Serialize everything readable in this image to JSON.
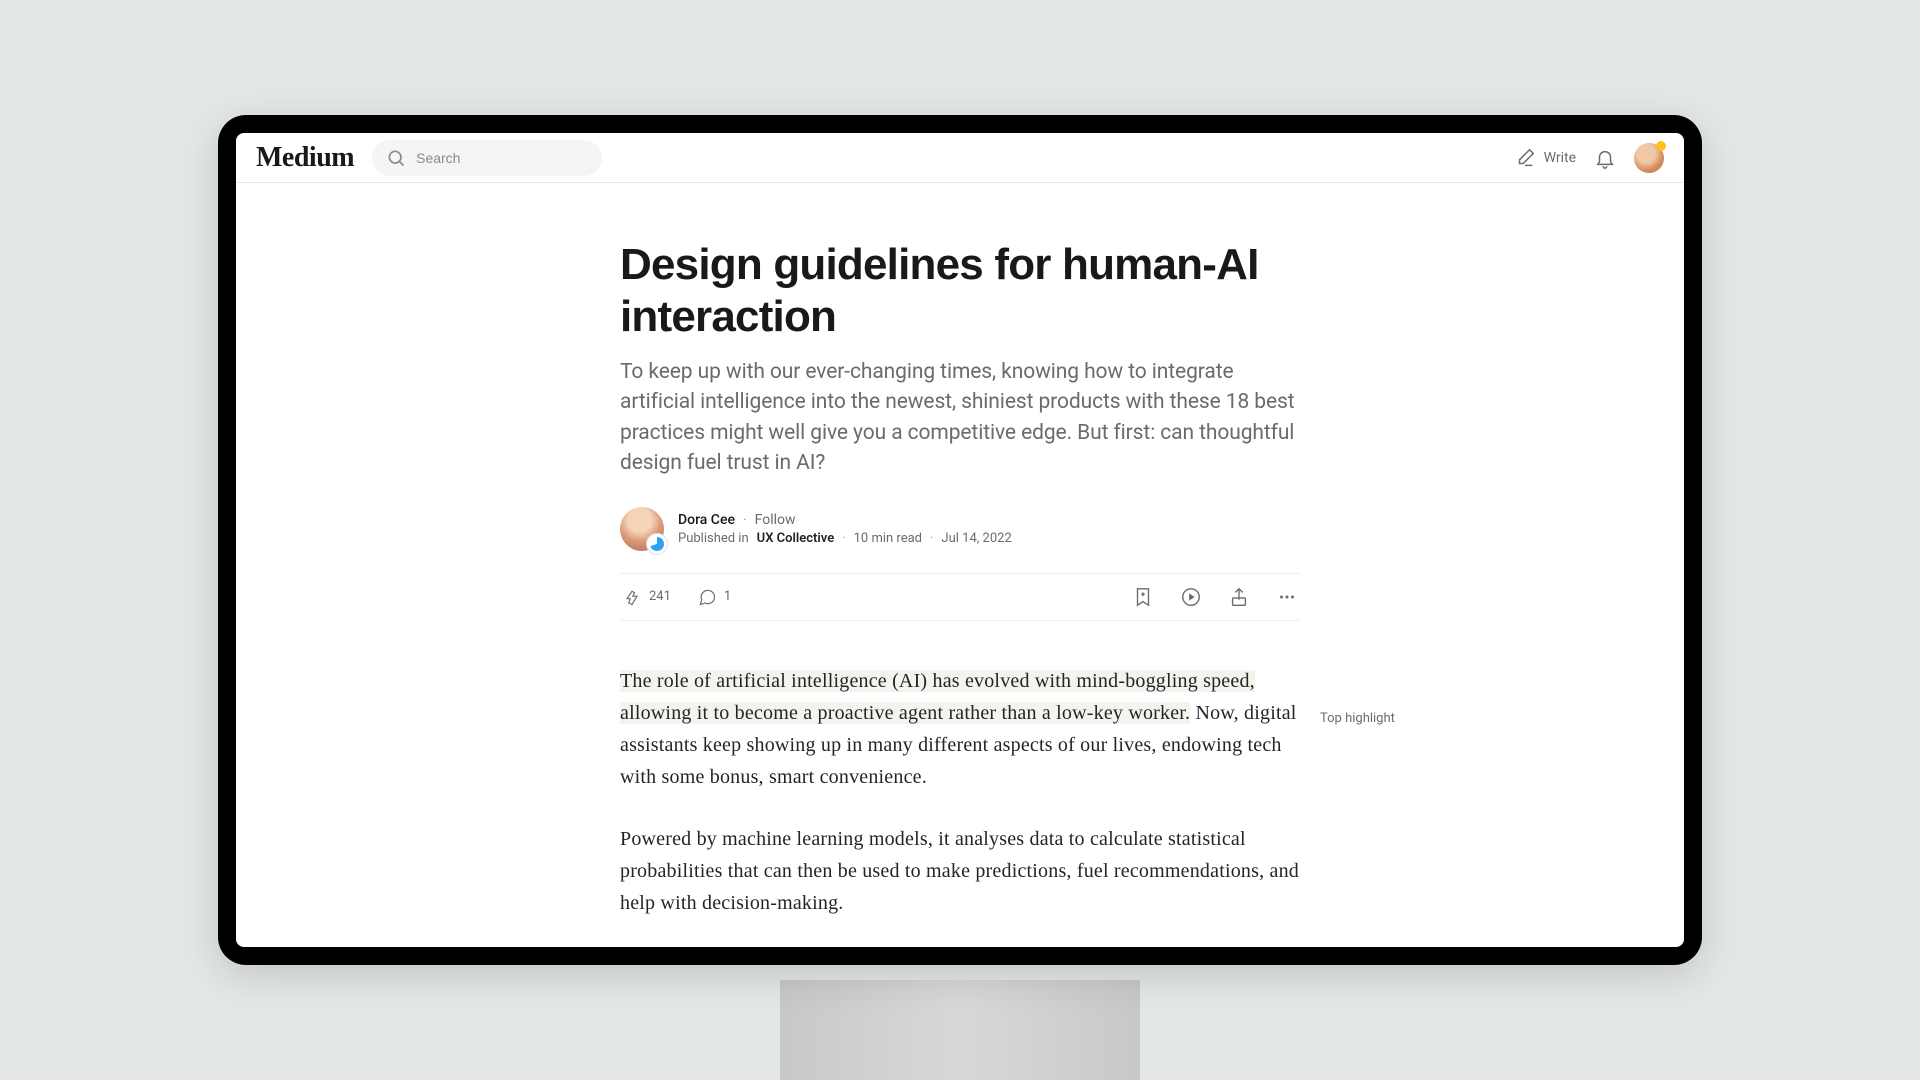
{
  "header": {
    "logo": "Medium",
    "search_placeholder": "Search",
    "write_label": "Write"
  },
  "article": {
    "title": "Design guidelines for human-AI interaction",
    "subtitle": "To keep up with our ever-changing times, knowing how to integrate artificial intelligence into the newest, shiniest products with these 18 best practices might well give you a competitive edge. But first: can thoughtful design fuel trust in AI?",
    "author": "Dora Cee",
    "follow_label": "Follow",
    "published_in_prefix": "Published in",
    "publication": "UX Collective",
    "read_time": "10 min read",
    "date": "Jul 14, 2022",
    "claps": "241",
    "comments": "1",
    "para1_hl": "The role of artificial intelligence (AI) has evolved with mind-boggling speed, allowing it to become a proactive agent rather than a low-key worker.",
    "para1_rest": " Now, digital assistants keep showing up in many different aspects of our lives, endowing tech with some bonus, smart convenience.",
    "para2": "Powered by machine learning models, it analyses data to calculate statistical probabilities that can then be used to make predictions, fuel recommendations, and help with decision-making."
  },
  "aside": {
    "top_highlight": "Top highlight"
  }
}
